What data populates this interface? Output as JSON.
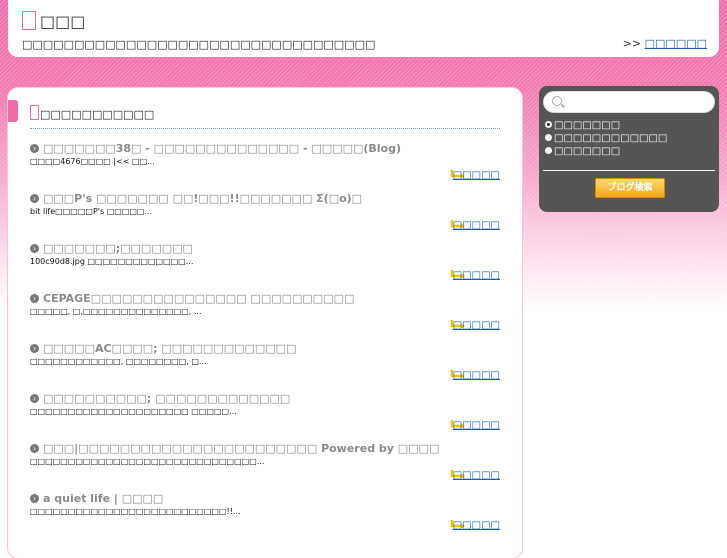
{
  "header": {
    "title": "□□□",
    "description": "□□□□□□□□□□□□□□□□□□□□□□□□□□□□□□□□□□",
    "link_prefix": ">>",
    "link_label": "□□□□□□"
  },
  "main": {
    "section_title": "□□□□□□□□□□□",
    "more_label": "□□□□□",
    "entries": [
      {
        "title": "□□□□□□□38□ - □□□□□□□□□□□□□□ - □□□□□(Blog)",
        "excerpt": "□□□□4676□□□□ |<< □□..."
      },
      {
        "title": "□□□P's □□□□□□□ □□!□□□!!□□□□□□□ Σ(□o)□",
        "excerpt": "bit life□□□□□P's □□□□□..."
      },
      {
        "title": "□□□□□□□;□□□□□□□",
        "excerpt": "100c90d8.jpg □□□□□□□□□□□□□..."
      },
      {
        "title": "CEPAGE□□□□□□□□□□□□□□□ □□□□□□□□□□",
        "excerpt": "□□□□□, □,□□□□□□□□□□□□□□, ..."
      },
      {
        "title": "□□□□□AC□□□□; □□□□□□□□□□□□□",
        "excerpt": "□□□□□□□□□□□□, □□□□□□□□, □..."
      },
      {
        "title": "□□□□□□□□□□; □□□□□□□□□□□□□",
        "excerpt": "□□□□□□□□□□□□□□□□□□□□□ □□□□□..."
      },
      {
        "title": "□□□|□□□□□□□□□□□□□□□□□□□□□□□ Powered by □□□□",
        "excerpt": "□□□□□□□□□□□□□□□□□□□□□□□□□□□□□□..."
      },
      {
        "title": "a quiet life | □□□□",
        "excerpt": "□□□□□□□□□□□□□□□□□□□□□□□□□□!!..."
      }
    ]
  },
  "sidebar": {
    "search_placeholder": "",
    "radio_options": [
      "□□□□□□□",
      "□□□□□□□□□□□□",
      "□□□□□□□"
    ],
    "search_button_label": "ブログ検索"
  },
  "colors": {
    "accent": "#f06aa8",
    "link": "#1a5fb4",
    "sidebar_bg": "#555555",
    "button": "#f5a623"
  },
  "icons": {
    "entry_bullet": "circle-arrow-icon",
    "more_link": "turn-arrow-icon",
    "search": "search-icon"
  }
}
